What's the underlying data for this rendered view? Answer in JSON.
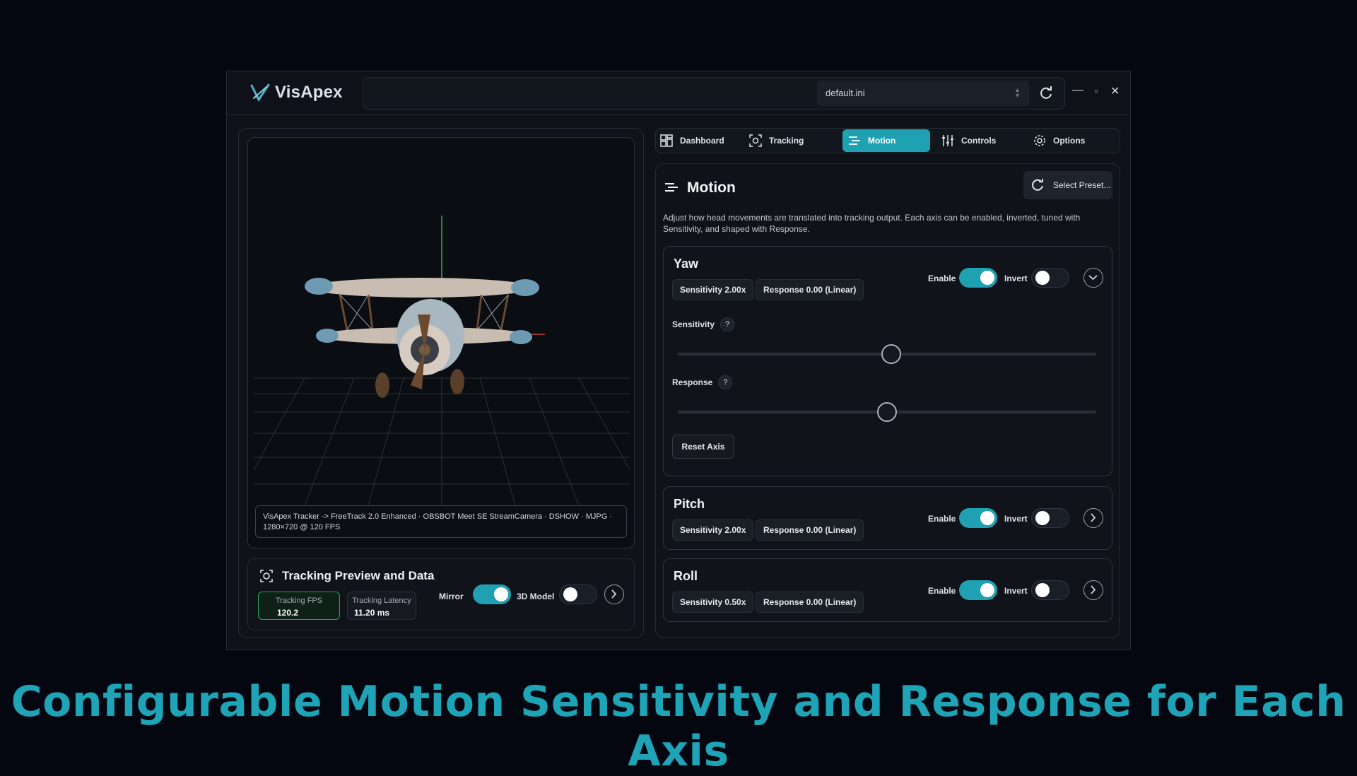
{
  "app": {
    "name": "VisApex",
    "preset_file": "default.ini",
    "window_controls": {
      "minimize": "—",
      "maximize": "▫",
      "close": "✕"
    }
  },
  "viewport": {
    "caption_line1": "VisApex Tracker -> FreeTrack 2.0 Enhanced · OBSBOT Meet SE StreamCamera · DSHOW · MJPG ·",
    "caption_line2": "1280×720 @ 120 FPS"
  },
  "tracking_panel": {
    "title": "Tracking Preview and Data",
    "fps_label": "Tracking FPS",
    "fps_value": "120.2",
    "latency_label": "Tracking Latency",
    "latency_value": "11.20 ms",
    "mirror_label": "Mirror",
    "mirror_on": true,
    "model_label": "3D Model",
    "model_on": false
  },
  "tabs": [
    {
      "label": "Dashboard",
      "icon": "dashboard-icon",
      "active": false
    },
    {
      "label": "Tracking",
      "icon": "tracking-icon",
      "active": false
    },
    {
      "label": "Motion",
      "icon": "motion-icon",
      "active": true
    },
    {
      "label": "Controls",
      "icon": "sliders-icon",
      "active": false
    },
    {
      "label": "Options",
      "icon": "gear-icon",
      "active": false
    }
  ],
  "motion": {
    "title": "Motion",
    "select_preset_label": "Select Preset...",
    "description": "Adjust how head movements are translated into tracking output. Each axis can be enabled, inverted, tuned with Sensitivity, and shaped with Response.",
    "enable_label": "Enable",
    "invert_label": "Invert",
    "axes": [
      {
        "name": "Yaw",
        "sensitivity_chip": "Sensitivity 2.00x",
        "response_chip": "Response 0.00 (Linear)",
        "enabled": true,
        "inverted": false,
        "expanded": true,
        "sensitivity_label": "Sensitivity",
        "response_label": "Response",
        "sensitivity_slider_fraction": 0.51,
        "response_slider_fraction": 0.5,
        "reset_label": "Reset Axis",
        "help_symbol": "?"
      },
      {
        "name": "Pitch",
        "sensitivity_chip": "Sensitivity 2.00x",
        "response_chip": "Response 0.00 (Linear)",
        "enabled": true,
        "inverted": false,
        "expanded": false
      },
      {
        "name": "Roll",
        "sensitivity_chip": "Sensitivity 0.50x",
        "response_chip": "Response 0.00 (Linear)",
        "enabled": true,
        "inverted": false,
        "expanded": false
      }
    ]
  },
  "headline": "Configurable Motion Sensitivity and Response for Each Axis",
  "colors": {
    "accent": "#1fa1b1",
    "background": "#04070f",
    "panel": "#0f1319",
    "good": "#1f8f4a"
  }
}
